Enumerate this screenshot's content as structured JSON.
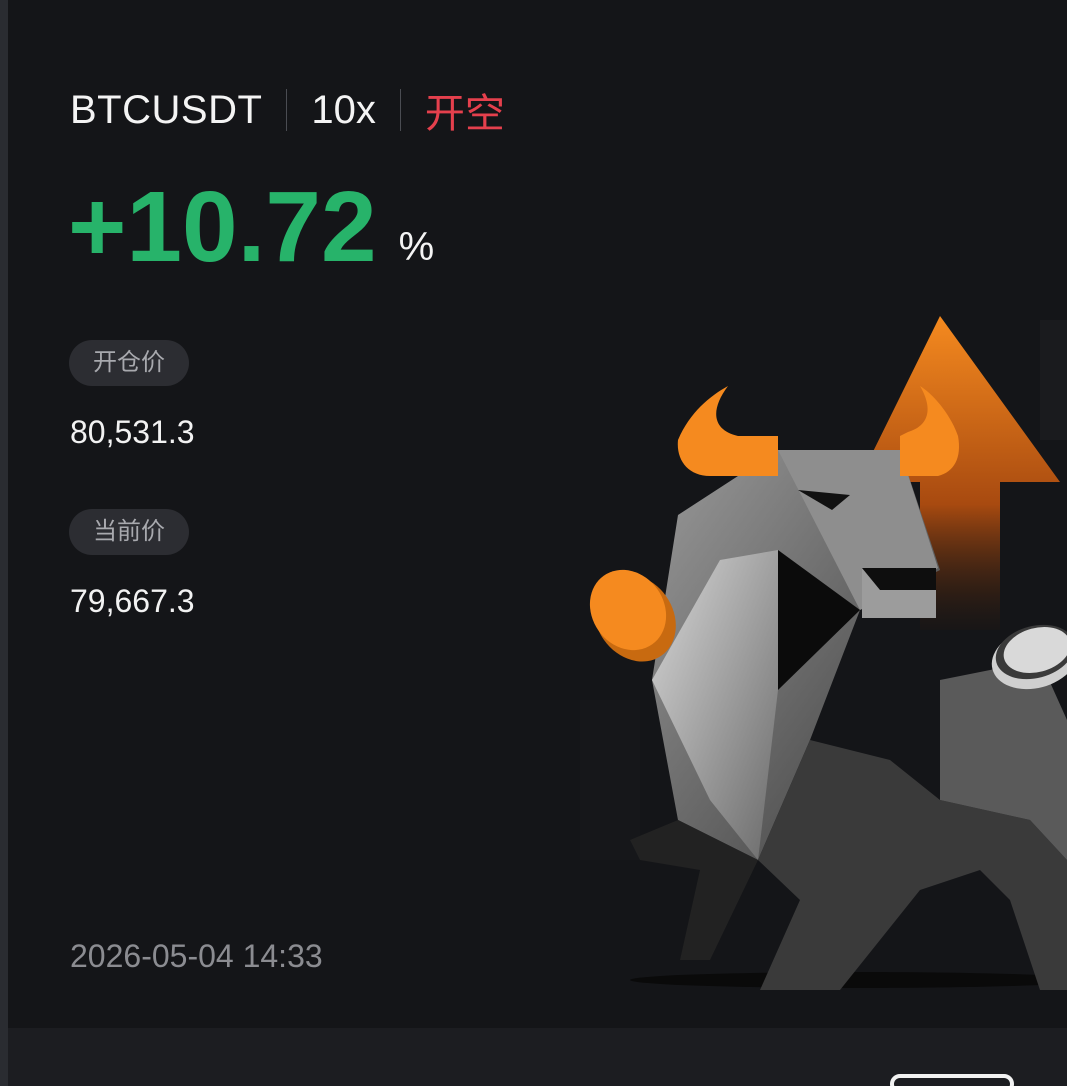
{
  "position": {
    "pair": "BTCUSDT",
    "leverage": "10x",
    "side": "开空",
    "pnl_value": "+10.72",
    "pnl_unit": "%"
  },
  "entry": {
    "label": "开仓价",
    "value": "80,531.3"
  },
  "current": {
    "label": "当前价",
    "value": "79,667.3"
  },
  "timestamp": "2026-05-04 14:33",
  "colors": {
    "background": "#141518",
    "profit_green": "#27b36a",
    "short_red": "#e5404d",
    "accent_orange": "#f58a1f"
  },
  "illustration": {
    "icon": "bull-with-up-arrow-and-coins"
  }
}
